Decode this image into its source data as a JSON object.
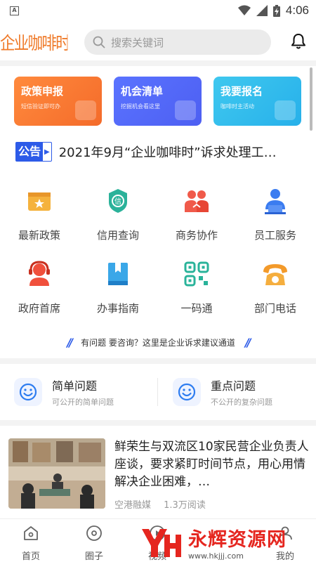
{
  "status_bar": {
    "time": "4:06",
    "app_badge": "A"
  },
  "header": {
    "logo": "企业咖啡时",
    "search_placeholder": "搜索关键词"
  },
  "cards": [
    {
      "title": "政策申报",
      "subtitle": "短信验证即可办"
    },
    {
      "title": "机会清单",
      "subtitle": "挖掘机会看这里"
    },
    {
      "title": "我要报名",
      "subtitle": "咖啡时主活动"
    }
  ],
  "notice": {
    "badge": "公告",
    "text": "2021年9月“企业咖啡时”诉求处理工…"
  },
  "grid": [
    {
      "label": "最新政策",
      "icon": "policy-icon",
      "color": "#f2a32f"
    },
    {
      "label": "信用查询",
      "icon": "credit-icon",
      "color": "#2bb29a"
    },
    {
      "label": "商务协作",
      "icon": "cooperation-icon",
      "color": "#f05a4a"
    },
    {
      "label": "员工服务",
      "icon": "employee-icon",
      "color": "#3b7cf0"
    },
    {
      "label": "政府首席",
      "icon": "government-icon",
      "color": "#f0503c"
    },
    {
      "label": "办事指南",
      "icon": "guide-icon",
      "color": "#3aa7e8"
    },
    {
      "label": "一码通",
      "icon": "qrcode-icon",
      "color": "#29b39a"
    },
    {
      "label": "部门电话",
      "icon": "phone-icon",
      "color": "#f39a2a"
    }
  ],
  "consult": {
    "text": "有问题 要咨询？这里是企业诉求建议通道"
  },
  "questions": [
    {
      "title": "简单问题",
      "subtitle": "可公开的简单问题"
    },
    {
      "title": "重点问题",
      "subtitle": "不公开的复杂问题"
    }
  ],
  "news": {
    "title": "鲜荣生与双流区10家民营企业负责人座谈，要求紧盯时间节点，用心用情解决企业困难，…",
    "source": "空港融媒",
    "reads": "1.3万阅读"
  },
  "tabbar": [
    {
      "label": "首页"
    },
    {
      "label": "圈子"
    },
    {
      "label": "视频"
    },
    {
      "label": "我的"
    }
  ],
  "watermark": {
    "title": "永辉资源网",
    "url": "www.hkjjj.com"
  }
}
